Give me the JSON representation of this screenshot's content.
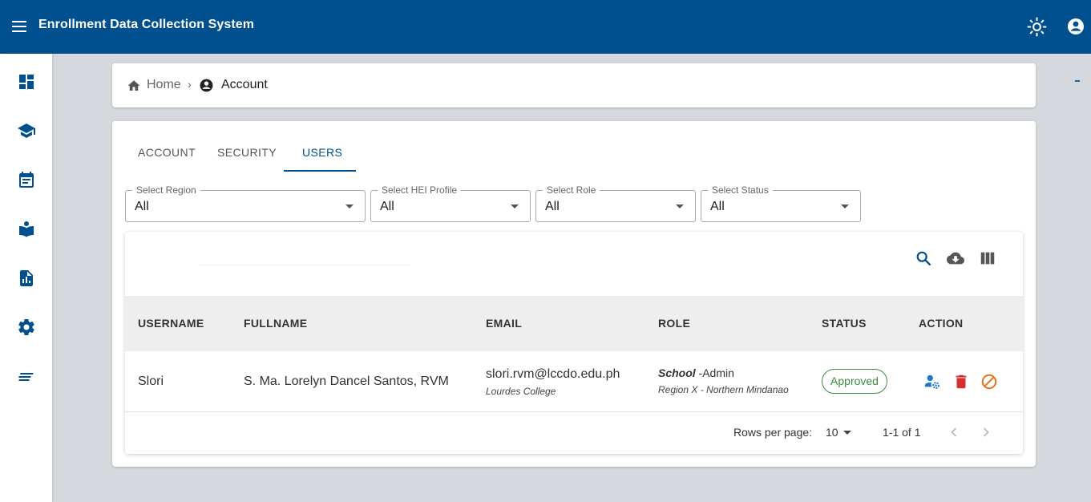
{
  "app": {
    "title": "Enrollment Data Collection System"
  },
  "icons": {
    "menu": "menu-icon",
    "theme": "sun-icon",
    "account": "account-circle-icon",
    "nav": [
      "dashboard-icon",
      "school-icon",
      "calendar-icon",
      "reading-icon",
      "report-icon",
      "settings-icon",
      "list-icon"
    ],
    "toolbar": [
      "search-icon",
      "cloud-download-icon",
      "columns-icon"
    ],
    "actions": [
      "manage-user-icon",
      "delete-icon",
      "block-icon"
    ]
  },
  "colors": {
    "primary": "#00508f",
    "approved": "#3d8b40",
    "delete": "#d32f2f",
    "block": "#e8711c",
    "manage": "#1976d2"
  },
  "breadcrumb": {
    "home": "Home",
    "separator": "›",
    "current": "Account"
  },
  "tabs": [
    {
      "label": "ACCOUNT",
      "active": false
    },
    {
      "label": "SECURITY",
      "active": false
    },
    {
      "label": "USERS",
      "active": true
    }
  ],
  "filters": [
    {
      "label": "Select Region",
      "value": "All"
    },
    {
      "label": "Select HEI Profile",
      "value": "All"
    },
    {
      "label": "Select Role",
      "value": "All"
    },
    {
      "label": "Select Status",
      "value": "All"
    }
  ],
  "table": {
    "columns": [
      "USERNAME",
      "FULLNAME",
      "EMAIL",
      "ROLE",
      "STATUS",
      "ACTION"
    ],
    "rows": [
      {
        "username": "Slori",
        "fullname": "S. Ma. Lorelyn Dancel Santos, RVM",
        "email": "slori.rvm@lccdo.edu.ph",
        "institution": "Lourdes College",
        "role_type": "School",
        "role_name": " -Admin",
        "region": "Region X - Northern Mindanao",
        "status": "Approved"
      }
    ],
    "footer": {
      "rows_per_page_label": "Rows per page:",
      "rows_per_page": "10",
      "range": "1-1 of 1"
    }
  }
}
